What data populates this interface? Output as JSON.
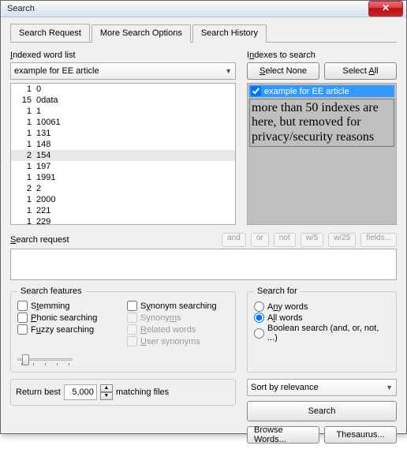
{
  "window": {
    "title": "Search"
  },
  "tabs": [
    {
      "label": "Search Request",
      "active": true
    },
    {
      "label": "More Search Options",
      "active": false
    },
    {
      "label": "Search History",
      "active": false
    }
  ],
  "wordlist": {
    "label": "Indexed word list",
    "combo": "example for EE article",
    "rows": [
      {
        "count": "1",
        "word": "0"
      },
      {
        "count": "15",
        "word": "0data"
      },
      {
        "count": "1",
        "word": "1"
      },
      {
        "count": "1",
        "word": "10061"
      },
      {
        "count": "1",
        "word": "131"
      },
      {
        "count": "1",
        "word": "148"
      },
      {
        "count": "2",
        "word": "154",
        "selected": true
      },
      {
        "count": "1",
        "word": "197"
      },
      {
        "count": "1",
        "word": "1991"
      },
      {
        "count": "2",
        "word": "2"
      },
      {
        "count": "1",
        "word": "2000"
      },
      {
        "count": "1",
        "word": "221"
      },
      {
        "count": "1",
        "word": "229"
      }
    ]
  },
  "indexes": {
    "label": "Indexes to search",
    "select_none": "Select None",
    "select_all": "Select All",
    "item": "example for EE article",
    "note": "more than 50 indexes are here, but removed for privacy/security reasons"
  },
  "search_request": {
    "label": "Search request",
    "value": "",
    "ops": [
      "and",
      "or",
      "not",
      "w/5",
      "w/25",
      "fields..."
    ]
  },
  "features": {
    "legend": "Search features",
    "stemming": "Stemming",
    "synonym_searching": "Synonym searching",
    "phonic": "Phonic searching",
    "synonyms": "Synonyms",
    "fuzzy": "Fuzzy searching",
    "related": "Related words",
    "user_syn": "User synonyms"
  },
  "searchfor": {
    "legend": "Search for",
    "any": "Any words",
    "all": "All words",
    "bool": "Boolean search (and, or, not, ...)",
    "selected": "all"
  },
  "sort": {
    "value": "Sort by relevance"
  },
  "return_best": {
    "prefix": "Return best",
    "value": "5,000",
    "suffix": "matching files"
  },
  "buttons": {
    "search": "Search",
    "browse": "Browse Words...",
    "thesaurus": "Thesaurus..."
  }
}
